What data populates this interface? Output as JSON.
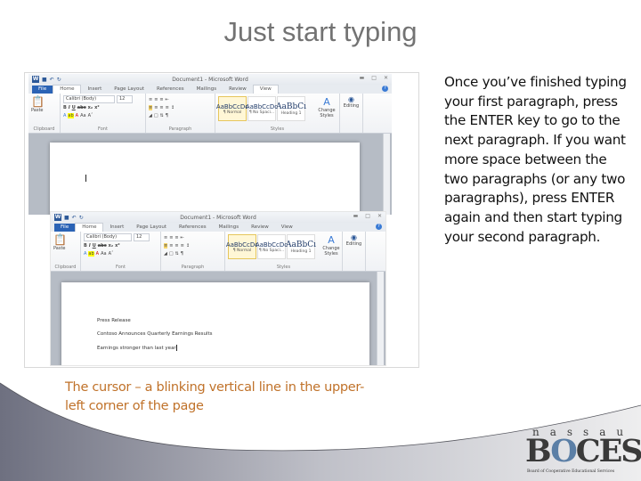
{
  "slide": {
    "title": "Just start typing",
    "side_text": "Once you’ve finished typing your first paragraph, press the ENTER key to go to the next paragraph. If you want more space between the two paragraphs (or any two paragraphs), press ENTER again and then start typing your second paragraph.",
    "caption": "The cursor – a blinking vertical line in the upper-left corner of the page",
    "caption_color": "#c0722a"
  },
  "word": {
    "window_title": "Document1 - Microsoft Word",
    "app_icon": "W",
    "tabs": [
      "File",
      "Home",
      "Insert",
      "Page Layout",
      "References",
      "Mailings",
      "Review",
      "View"
    ],
    "active_tab": "Home",
    "groups": {
      "clipboard": "Clipboard",
      "font": "Font",
      "paragraph": "Paragraph",
      "styles": "Styles"
    },
    "paste_label": "Paste",
    "font_name": "Calibri (Body)",
    "font_size": "12",
    "styles": [
      {
        "preview": "AaBbCcDc",
        "name": "¶ Normal"
      },
      {
        "preview": "AaBbCcDc",
        "name": "¶ No Spaci..."
      },
      {
        "preview": "AaBbCı",
        "name": "Heading 1"
      }
    ],
    "change_styles": "Change Styles",
    "editing": "Editing",
    "help": "?",
    "doc2_lines": [
      "Press Release",
      "Contoso Announces Quarterly Earnings Results",
      "Earnings stronger than last year"
    ]
  },
  "logo": {
    "top": "nassau",
    "main_b": "B",
    "main_o": "O",
    "main_rest": "CES",
    "sub": "Board of Cooperative Educational Services"
  }
}
